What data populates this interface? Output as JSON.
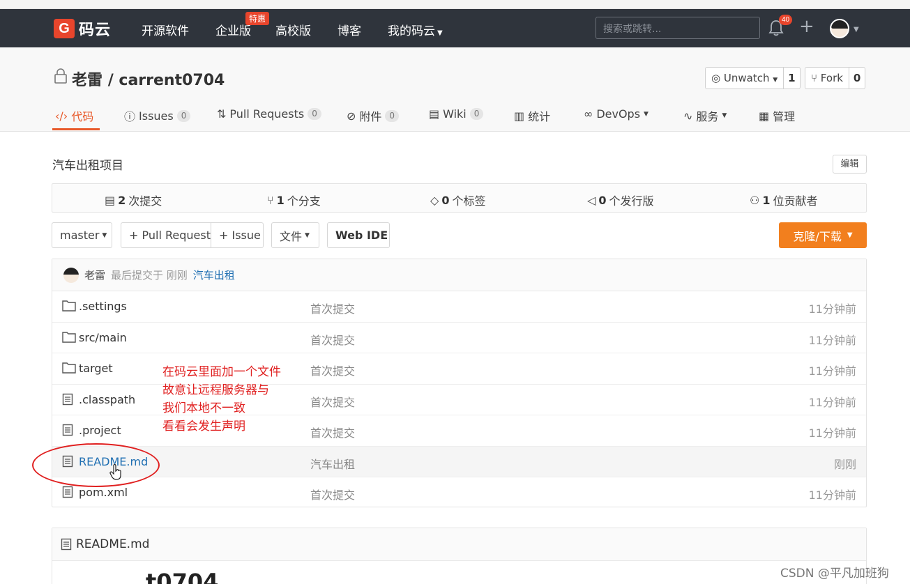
{
  "navbar": {
    "logo_text": "码云",
    "items": [
      "开源软件",
      "企业版",
      "高校版",
      "博客",
      "我的码云"
    ],
    "promo_badge": "特惠",
    "search_placeholder": "搜索或跳转...",
    "notification_count": "40"
  },
  "repo": {
    "owner": "老雷",
    "separator": "/",
    "name": "carrent0704",
    "watch_label": "Unwatch",
    "watch_count": "1",
    "fork_label": "Fork",
    "fork_count": "0",
    "tabs": [
      {
        "label": "代码"
      },
      {
        "label": "Issues",
        "count": "0"
      },
      {
        "label": "Pull Requests",
        "count": "0"
      },
      {
        "label": "附件",
        "count": "0"
      },
      {
        "label": "Wiki",
        "count": "0"
      },
      {
        "label": "统计"
      },
      {
        "label": "DevOps"
      },
      {
        "label": "服务"
      },
      {
        "label": "管理"
      }
    ],
    "description": "汽车出租项目",
    "edit_label": "编辑"
  },
  "stats": {
    "commits_num": "2",
    "commits_label": "次提交",
    "branches_num": "1",
    "branches_label": "个分支",
    "tags_num": "0",
    "tags_label": "个标签",
    "releases_num": "0",
    "releases_label": "个发行版",
    "contributors_num": "1",
    "contributors_label": "位贡献者"
  },
  "toolbar": {
    "branch": "master",
    "pull_request": "+ Pull Request",
    "issue": "+ Issue",
    "files": "文件",
    "web_ide": "Web IDE",
    "clone": "克隆/下载"
  },
  "last_commit": {
    "author": "老雷",
    "text": "最后提交于 刚刚",
    "message": "汽车出租"
  },
  "files": [
    {
      "name": ".settings",
      "type": "folder",
      "message": "首次提交",
      "time": "11分钟前"
    },
    {
      "name": "src/main",
      "type": "folder",
      "message": "首次提交",
      "time": "11分钟前"
    },
    {
      "name": "target",
      "type": "folder",
      "message": "首次提交",
      "time": "11分钟前"
    },
    {
      "name": ".classpath",
      "type": "file",
      "message": "首次提交",
      "time": "11分钟前"
    },
    {
      "name": ".project",
      "type": "file",
      "message": "首次提交",
      "time": "11分钟前"
    },
    {
      "name": "README.md",
      "type": "file",
      "message": "汽车出租",
      "time": "刚刚"
    },
    {
      "name": "pom.xml",
      "type": "file",
      "message": "首次提交",
      "time": "11分钟前"
    }
  ],
  "annotation": {
    "lines": [
      "在码云里面加一个文件",
      "故意让远程服务器与",
      "我们本地不一致",
      "看看会发生声明"
    ]
  },
  "readme": {
    "title": "README.md",
    "heading_partial": "t0704"
  },
  "watermark": "CSDN @平凡加班狗",
  "colors": {
    "navbar_bg": "#2f343c",
    "accent_orange": "#f27f1e",
    "brand_red": "#e8452c",
    "link_blue": "#1f6fb2",
    "annotation_red": "#e02020"
  }
}
